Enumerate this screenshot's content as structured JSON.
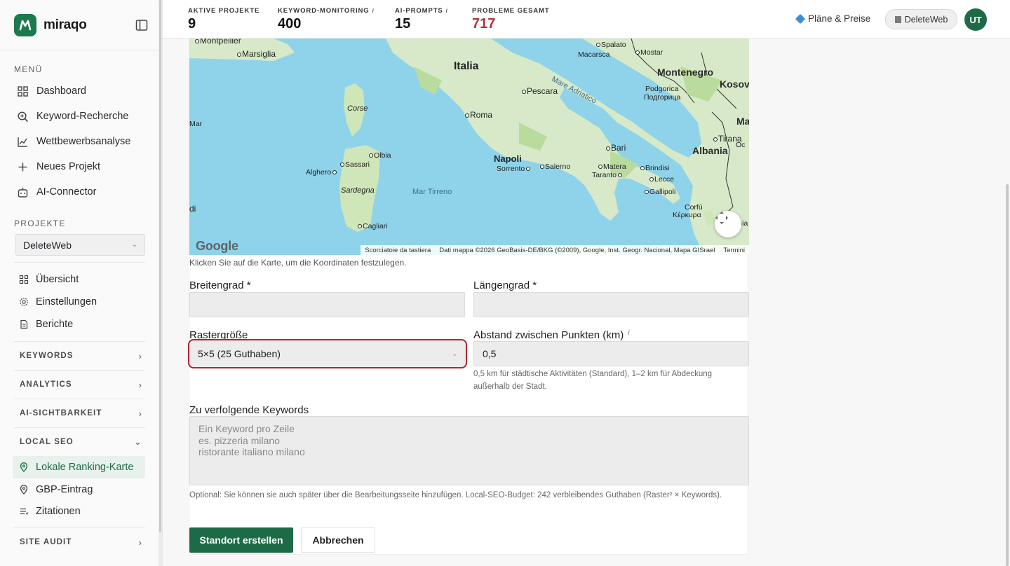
{
  "app": {
    "name": "miraqo"
  },
  "sidebar": {
    "menu_title": "MENÜ",
    "menu": [
      {
        "label": "Dashboard",
        "icon": "grid-icon"
      },
      {
        "label": "Keyword-Recherche",
        "icon": "search-icon"
      },
      {
        "label": "Wettbewerbsanalyse",
        "icon": "chart-line-icon"
      },
      {
        "label": "Neues Projekt",
        "icon": "plus-icon"
      },
      {
        "label": "AI-Connector",
        "icon": "robot-icon"
      }
    ],
    "projects_title": "PROJEKTE",
    "project_selected": "DeleteWeb",
    "project_items": [
      {
        "label": "Übersicht",
        "icon": "grid-icon"
      },
      {
        "label": "Einstellungen",
        "icon": "gear-icon"
      },
      {
        "label": "Berichte",
        "icon": "document-icon"
      }
    ],
    "groups": {
      "keywords": "KEYWORDS",
      "analytics": "ANALYTICS",
      "ai": "AI-SICHTBARKEIT",
      "local": "LOCAL SEO",
      "audit": "SITE AUDIT"
    },
    "local_items": [
      {
        "label": "Lokale Ranking-Karte",
        "icon": "map-pin-icon",
        "active": true
      },
      {
        "label": "GBP-Eintrag",
        "icon": "map-pin-icon"
      },
      {
        "label": "Zitationen",
        "icon": "list-icon"
      }
    ]
  },
  "header": {
    "stats": [
      {
        "label": "AKTIVE PROJEKTE",
        "value": "9",
        "info": ""
      },
      {
        "label": "KEYWORD-MONITORING",
        "value": "400",
        "info": "i"
      },
      {
        "label": "AI-PROMPTS",
        "value": "15",
        "info": "i"
      },
      {
        "label": "PROBLEME GESAMT",
        "value": "717",
        "info": ""
      }
    ],
    "plans_label": "Pläne & Preise",
    "workspace_label": "DeleteWeb",
    "avatar_initials": "UT"
  },
  "map": {
    "labels": {
      "montpellier": "Montpellier",
      "marsiglia": "Marsiglia",
      "italia": "Italia",
      "corse": "Corse",
      "roma": "Roma",
      "pescara": "Pescara",
      "spalato": "Spalato",
      "macarsca": "Macarsca",
      "mostar": "Mostar",
      "montenegro": "Montenegro",
      "podgorica": "Podgorica",
      "podgorica_cyr": "Подгорица",
      "kosovo": "Kosov",
      "mare_adriatico": "Mare Adriatico",
      "bari": "Bari",
      "napoli": "Napoli",
      "sorrento": "Sorrento",
      "salerno": "Salerno",
      "matera": "Matera",
      "taranto": "Taranto",
      "brindisi": "Brindisi",
      "lecce": "Lecce",
      "gallipoli": "Gallipoli",
      "tirana": "Tirana",
      "albania": "Albania",
      "olbia": "Olbia",
      "sassari": "Sassari",
      "alghero": "Alghero",
      "sardegna": "Sardegna",
      "mar_tirreno": "Mar Tirreno",
      "cagliari": "Cagliari",
      "mar": "Mar",
      "corfu": "Corfù",
      "kerkyra": "Κέρκυρα",
      "ma": "Ma",
      "oc": "Oc",
      "gia": "Gia",
      "di": "di"
    },
    "google": "Google",
    "attr_shortcuts": "Scorciatoie da tastiera",
    "attr_data": "Dati mappa ©2026 GeoBasis-DE/BKG (©2009), Google, Inst. Geogr. Nacional, Mapa GISrael",
    "attr_terms": "Termini",
    "hint": "Klicken Sie auf die Karte, um die Koordinaten festzulegen."
  },
  "form": {
    "lat_label": "Breitengrad *",
    "lat_value": "",
    "lng_label": "Längengrad *",
    "lng_value": "",
    "grid_label": "Rastergröße",
    "grid_value": "5×5 (25 Guthaben)",
    "distance_label": "Abstand zwischen Punkten (km)",
    "distance_info": "i",
    "distance_value": "0,5",
    "distance_help": "0,5 km für städtische Aktivitäten (Standard), 1–2 km für Abdeckung außerhalb der Stadt.",
    "keywords_label": "Zu verfolgende Keywords",
    "keywords_placeholder": "Ein Keyword pro Zeile\nes. pizzeria milano\nristorante italiano milano",
    "keywords_help": "Optional: Sie können sie auch später über die Bearbeitungsseite hinzufügen. Local-SEO-Budget: 242 verbleibendes Guthaben (Raster² × Keywords).",
    "submit_label": "Standort erstellen",
    "cancel_label": "Abbrechen"
  },
  "colors": {
    "brand": "#1d6b46",
    "error": "#b2262b",
    "problems": "#b0343a",
    "sea": "#8fd3ea",
    "land": "#d7e9c8"
  }
}
